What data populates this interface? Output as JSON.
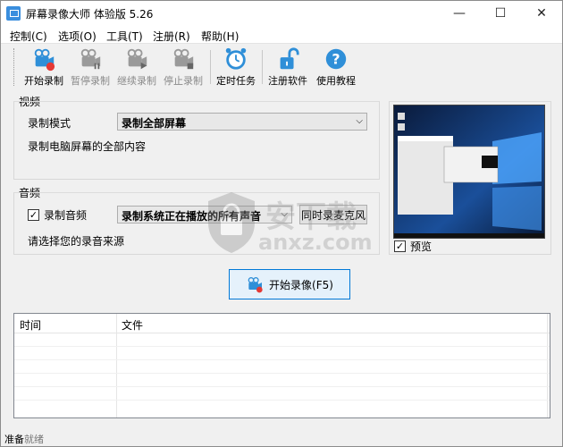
{
  "window": {
    "title": "屏幕录像大师 体验版 5.26",
    "minimize": "—",
    "maximize": "☐",
    "close": "✕"
  },
  "menu": [
    "控制(C)",
    "选项(O)",
    "工具(T)",
    "注册(R)",
    "帮助(H)"
  ],
  "toolbar": {
    "start_record": "开始录制",
    "pause_record": "暂停录制",
    "resume_record": "继续录制",
    "stop_record": "停止录制",
    "scheduled_task": "定时任务",
    "register": "注册软件",
    "tutorial": "使用教程"
  },
  "video": {
    "group_title": "视频",
    "mode_label": "录制模式",
    "mode_value": "录制全部屏幕",
    "description": "录制电脑屏幕的全部内容"
  },
  "audio": {
    "group_title": "音频",
    "record_audio_label": "录制音频",
    "record_audio_checked": true,
    "source_value": "录制系统正在播放的所有声音",
    "mic_button": "同时录麦克风",
    "hint": "请选择您的录音来源"
  },
  "preview": {
    "label": "预览",
    "checked": true
  },
  "start_button": "开始录像(F5)",
  "list": {
    "columns": [
      "时间",
      "文件"
    ]
  },
  "watermark_text": "安下载",
  "watermark_url": "anxz.com",
  "status": {
    "left": "准备",
    "right": "就绪"
  },
  "colors": {
    "accent": "#0078d7",
    "icon_blue": "#2f8fd8",
    "record_red": "#e53935",
    "disabled": "#8a8a8a"
  }
}
